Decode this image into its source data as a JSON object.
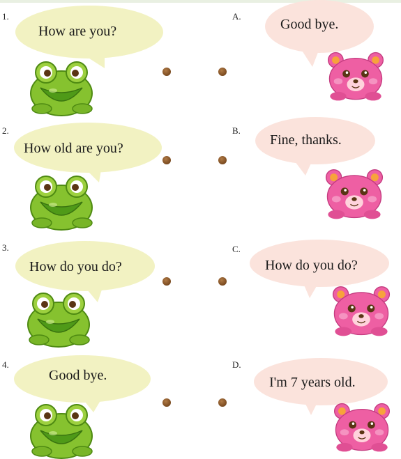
{
  "colors": {
    "frog_bubble": "#f2f2c2",
    "bear_bubble": "#fbe3dc",
    "frog_body": "#86c22f",
    "bear_body": "#ee5fa3",
    "dot": "#7a4a1f"
  },
  "left_items": [
    {
      "number": "1.",
      "text": "How are you?",
      "icon": "frog-icon"
    },
    {
      "number": "2.",
      "text": "How old are you?",
      "icon": "frog-icon"
    },
    {
      "number": "3.",
      "text": "How do you do?",
      "icon": "frog-icon"
    },
    {
      "number": "4.",
      "text": "Good bye.",
      "icon": "frog-icon"
    }
  ],
  "right_items": [
    {
      "letter": "A.",
      "text": "Good bye.",
      "icon": "bear-icon"
    },
    {
      "letter": "B.",
      "text": "Fine, thanks.",
      "icon": "bear-icon"
    },
    {
      "letter": "C.",
      "text": "How do you do?",
      "icon": "bear-icon"
    },
    {
      "letter": "D.",
      "text": "I'm 7 years old.",
      "icon": "bear-icon"
    }
  ]
}
